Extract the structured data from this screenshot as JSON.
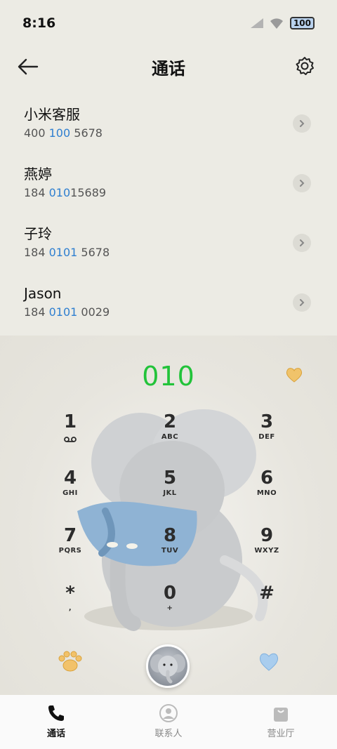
{
  "status_bar": {
    "time": "8:16",
    "battery": "100"
  },
  "header": {
    "title": "通话"
  },
  "contacts": [
    {
      "name": "小米客服",
      "number_pre": "400 ",
      "number_match": "100",
      "number_post": " 5678"
    },
    {
      "name": "燕婷",
      "number_pre": "184 ",
      "number_match": "010",
      "number_post": "15689"
    },
    {
      "name": "子玲",
      "number_pre": "184 ",
      "number_match": "0101",
      "number_post": " 5678"
    },
    {
      "name": "Jason",
      "number_pre": "184 ",
      "number_match": "0101",
      "number_post": " 0029"
    }
  ],
  "dialer": {
    "display": "010",
    "keys": [
      {
        "digit": "1",
        "letters": ""
      },
      {
        "digit": "2",
        "letters": "ABC"
      },
      {
        "digit": "3",
        "letters": "DEF"
      },
      {
        "digit": "4",
        "letters": "GHI"
      },
      {
        "digit": "5",
        "letters": "JKL"
      },
      {
        "digit": "6",
        "letters": "MNO"
      },
      {
        "digit": "7",
        "letters": "PQRS"
      },
      {
        "digit": "8",
        "letters": "TUV"
      },
      {
        "digit": "9",
        "letters": "WXYZ"
      },
      {
        "digit": "*",
        "letters": ","
      },
      {
        "digit": "0",
        "letters": "+"
      },
      {
        "digit": "#",
        "letters": ""
      }
    ]
  },
  "tabs": [
    {
      "label": "通话",
      "icon": "phone-icon",
      "active": true
    },
    {
      "label": "联系人",
      "icon": "person-icon",
      "active": false
    },
    {
      "label": "营业厅",
      "icon": "bag-icon",
      "active": false
    }
  ],
  "colors": {
    "accent_green": "#22c33a",
    "match_blue": "#2f7fd0",
    "background": "#ecebe4"
  }
}
